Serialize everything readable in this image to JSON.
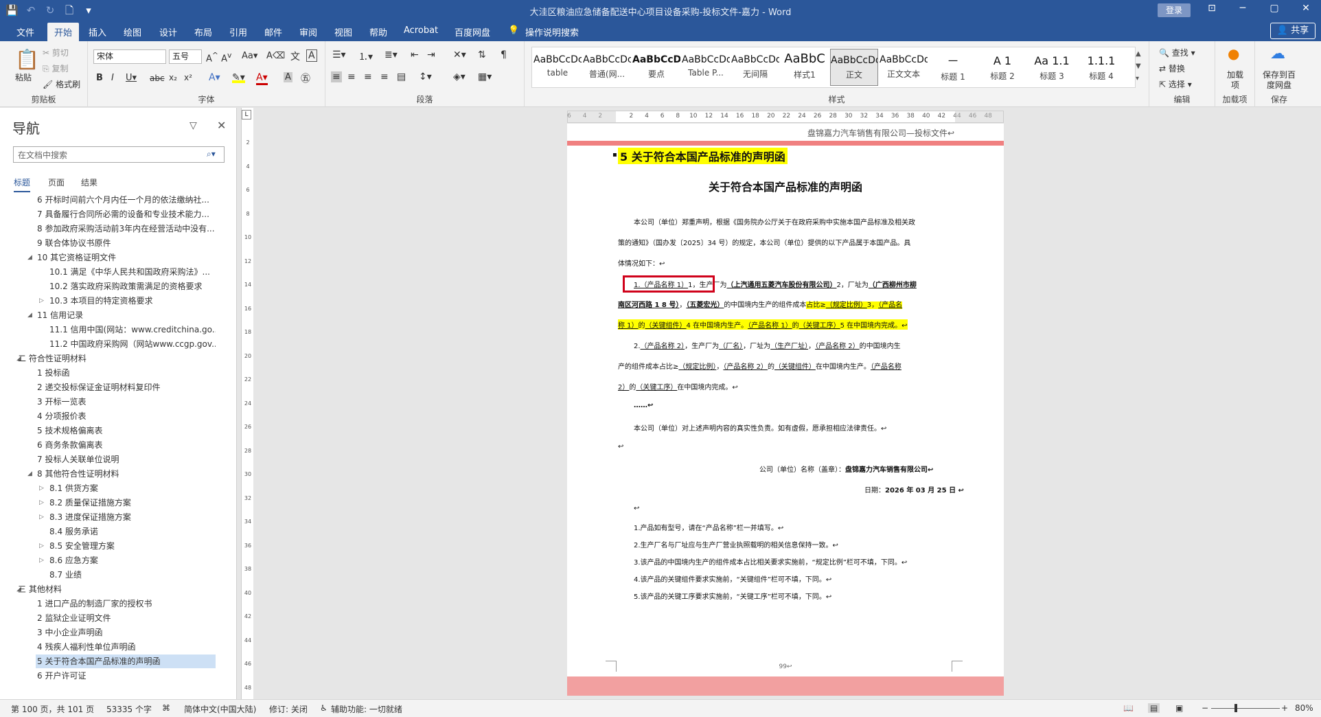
{
  "window": {
    "title": "大洼区粮油应急储备配送中心项目设备采购-投标文件-嘉力  -  Word",
    "login": "登录",
    "min": "─",
    "max": "▢",
    "close": "✕",
    "ribbon_toggle": "⊡"
  },
  "qat": {
    "save": "💾",
    "undo": "↶",
    "redo": "↻",
    "new": "🗋",
    "more": "▾"
  },
  "tabs": [
    "文件",
    "开始",
    "插入",
    "绘图",
    "设计",
    "布局",
    "引用",
    "邮件",
    "审阅",
    "视图",
    "帮助",
    "Acrobat",
    "百度网盘"
  ],
  "active_tab": "开始",
  "tell_me": "操作说明搜索",
  "share": "共享",
  "ribbon": {
    "clipboard": {
      "paste": "粘贴",
      "cut": "剪切",
      "copy": "复制",
      "format_painter": "格式刷",
      "label": "剪贴板"
    },
    "font": {
      "name": "宋体",
      "size": "五号",
      "label": "字体"
    },
    "paragraph": {
      "label": "段落"
    },
    "styles": {
      "label": "样式",
      "items": [
        {
          "preview": "AaBbCcDc",
          "name": "table"
        },
        {
          "preview": "AaBbCcDc",
          "name": "普通(网..."
        },
        {
          "preview": "AaBbCcD",
          "name": "要点"
        },
        {
          "preview": "AaBbCcDdI",
          "name": "Table P..."
        },
        {
          "preview": "AaBbCcDdI",
          "name": "无间隔"
        },
        {
          "preview": "AaBbC",
          "name": "样式1"
        },
        {
          "preview": "AaBbCcDdI",
          "name": "正文"
        },
        {
          "preview": "AaBbCcDdI",
          "name": "正文文本"
        },
        {
          "preview": "一",
          "name": "标题 1"
        },
        {
          "preview": "A 1",
          "name": "标题 2"
        },
        {
          "preview": "Aa 1.1",
          "name": "标题 3"
        },
        {
          "preview": "1.1.1",
          "name": "标题 4"
        }
      ],
      "selected": "正文"
    },
    "editing": {
      "find": "查找",
      "replace": "替换",
      "select": "选择",
      "label": "编辑"
    },
    "addins": {
      "btn": "加载项",
      "label": "加载项"
    },
    "save": {
      "btn": "保存到百度网盘",
      "label": "保存"
    }
  },
  "nav": {
    "title": "导航",
    "search_placeholder": "在文档中搜索",
    "tabs": [
      "标题",
      "页面",
      "结果"
    ],
    "items": [
      {
        "text": "6 开标时间前六个月内任一个月的依法缴纳社...",
        "level": 2,
        "exp": ""
      },
      {
        "text": "7 具备履行合同所必需的设备和专业技术能力...",
        "level": 2,
        "exp": ""
      },
      {
        "text": "8 参加政府采购活动前3年内在经营活动中没有...",
        "level": 2,
        "exp": ""
      },
      {
        "text": "9 联合体协议书原件",
        "level": 2,
        "exp": ""
      },
      {
        "text": "10 其它资格证明文件",
        "level": 2,
        "exp": "◢"
      },
      {
        "text": "10.1 满足《中华人民共和国政府采购法》...",
        "level": 3,
        "exp": ""
      },
      {
        "text": "10.2 落实政府采购政策需满足的资格要求",
        "level": 3,
        "exp": ""
      },
      {
        "text": "10.3 本项目的特定资格要求",
        "level": 3,
        "exp": "▷"
      },
      {
        "text": "11 信用记录",
        "level": 2,
        "exp": "◢"
      },
      {
        "text": "11.1 信用中国(网站：www.creditchina.go...",
        "level": 3,
        "exp": ""
      },
      {
        "text": "11.2 中国政府采购网（网站www.ccgp.gov....",
        "level": 3,
        "exp": ""
      },
      {
        "text": "二 符合性证明材料",
        "level": 1,
        "exp": "◢"
      },
      {
        "text": "1 投标函",
        "level": 2,
        "exp": ""
      },
      {
        "text": "2 递交投标保证金证明材料复印件",
        "level": 2,
        "exp": ""
      },
      {
        "text": "3 开标一览表",
        "level": 2,
        "exp": ""
      },
      {
        "text": "4 分项报价表",
        "level": 2,
        "exp": ""
      },
      {
        "text": "5 技术规格偏离表",
        "level": 2,
        "exp": ""
      },
      {
        "text": "6 商务条款偏离表",
        "level": 2,
        "exp": ""
      },
      {
        "text": "7 投标人关联单位说明",
        "level": 2,
        "exp": ""
      },
      {
        "text": "8 其他符合性证明材料",
        "level": 2,
        "exp": "◢"
      },
      {
        "text": "8.1 供货方案",
        "level": 3,
        "exp": "▷"
      },
      {
        "text": "8.2 质量保证措施方案",
        "level": 3,
        "exp": "▷"
      },
      {
        "text": "8.3 进度保证措施方案",
        "level": 3,
        "exp": "▷"
      },
      {
        "text": "8.4 服务承诺",
        "level": 3,
        "exp": ""
      },
      {
        "text": "8.5 安全管理方案",
        "level": 3,
        "exp": "▷"
      },
      {
        "text": "8.6 应急方案",
        "level": 3,
        "exp": "▷"
      },
      {
        "text": "8.7 业绩",
        "level": 3,
        "exp": ""
      },
      {
        "text": "三 其他材料",
        "level": 1,
        "exp": "◢"
      },
      {
        "text": "1 进口产品的制造厂家的授权书",
        "level": 2,
        "exp": ""
      },
      {
        "text": "2 监狱企业证明文件",
        "level": 2,
        "exp": ""
      },
      {
        "text": "3 中小企业声明函",
        "level": 2,
        "exp": ""
      },
      {
        "text": "4 残疾人福利性单位声明函",
        "level": 2,
        "exp": ""
      },
      {
        "text": "5 关于符合本国产品标准的声明函",
        "level": 2,
        "exp": "",
        "sel": true
      },
      {
        "text": "6 开户许可证",
        "level": 2,
        "exp": ""
      }
    ]
  },
  "hruler_ticks": [
    "6",
    "4",
    "2",
    "",
    "2",
    "4",
    "6",
    "8",
    "10",
    "12",
    "14",
    "16",
    "18",
    "20",
    "22",
    "24",
    "26",
    "28",
    "30",
    "32",
    "34",
    "36",
    "38",
    "40",
    "42",
    "44",
    "46",
    "48"
  ],
  "vruler_ticks": [
    "2",
    "4",
    "6",
    "8",
    "10",
    "12",
    "14",
    "16",
    "18",
    "20",
    "22",
    "24",
    "26",
    "28",
    "30",
    "32",
    "34",
    "36",
    "38",
    "40",
    "42",
    "44",
    "46",
    "48"
  ],
  "doc": {
    "header": "盘锦嘉力汽车销售有限公司—投标文件↩",
    "heading": "5    关于符合本国产品标准的声明函",
    "center_title": "关于符合本国产品标准的声明函",
    "p1_l1": "本公司（单位）郑重声明，根据《国务院办公厅关于在政府采购中实施本国产品标准及相关政",
    "p1_l2": "策的通知》（国办发〔2025〕34 号）的规定，本公司（单位）提供的以下产品属于本国产品。具",
    "p1_l3": "体情况如下：↩",
    "i1_a": "1.（产品名称 1）",
    "i1_b": "1，",
    "i1_c": "生产厂为",
    "i1_d": "（上汽通用五菱汽车股份有限公司）",
    "i1_e": "2，厂址为",
    "i1_f": "（广西柳州市柳",
    "i1_l2a": "南区河西路 1 8 号）",
    "i1_l2b": "，",
    "i1_l2c": "（五菱宏光）",
    "i1_l2d": "的中国境内生产的组件成本",
    "i1_l2e": "占比≥",
    "i1_l2f": "（规定比例）",
    "i1_l2g": "3，",
    "i1_l2h": "（产品名",
    "i1_l3a": "称 1）",
    "i1_l3b": "的",
    "i1_l3c": "（关键组件）",
    "i1_l3d": "4 在中国境内生产。",
    "i1_l3e": "（产品名称 1）",
    "i1_l3f": "的",
    "i1_l3g": "（关键工序）",
    "i1_l3h": "5 在中国境内完成。↩",
    "i2_l1a": "2.",
    "i2_l1b": "（产品名称 2）",
    "i2_l1c": "，生产厂为",
    "i2_l1d": "（厂名）",
    "i2_l1e": "，厂址为",
    "i2_l1f": "（生产厂址）",
    "i2_l1g": "，",
    "i2_l1h": "（产品名称 2）",
    "i2_l1i": "的中国境内生",
    "i2_l2a": "产的组件成本占比≥",
    "i2_l2b": "（规定比例）",
    "i2_l2c": "，",
    "i2_l2d": "（产品名称 2）",
    "i2_l2e": "的",
    "i2_l2f": "（关键组件）",
    "i2_l2g": "在中国境内生产。",
    "i2_l2h": "（产品名称",
    "i2_l3a": "2）",
    "i2_l3b": "的",
    "i2_l3c": "（关键工序）",
    "i2_l3d": "在中国境内完成。↩",
    "ellipsis": "……↩",
    "responsibility": "本公司（单位）对上述声明内容的真实性负责。如有虚假，愿承担相应法律责任。↩",
    "blank1": "↩",
    "sign_label": "公司（单位）名称（盖章）：",
    "sign_name": "盘锦嘉力汽车销售有限公司↩",
    "date_label": "日期：",
    "date_value": "2026 年 03 月 25 日 ↩",
    "blank2": "↩",
    "notes": [
      "1.产品如有型号，请在“产品名称”栏一并填写。↩",
      "2.生产厂名与厂址应与生产厂营业执照载明的相关信息保持一致。↩",
      "3.该产品的中国境内生产的组件成本占比相关要求实施前，“规定比例”栏可不填，下同。↩",
      "4.该产品的关键组件要求实施前，“关键组件”栏可不填，下同。↩",
      "5.该产品的关键工序要求实施前，“关键工序”栏可不填，下同。↩"
    ],
    "page_num": "99↩"
  },
  "status": {
    "page": "第 100 页，共 101 页",
    "words": "53335 个字",
    "lang": "简体中文(中国大陆)",
    "track": "修订: 关闭",
    "access": "辅助功能: 一切就绪",
    "zoom": "80%"
  },
  "colors": {
    "accent": "#2b579a",
    "highlight": "#ffff00",
    "redbox": "#d0021b"
  }
}
